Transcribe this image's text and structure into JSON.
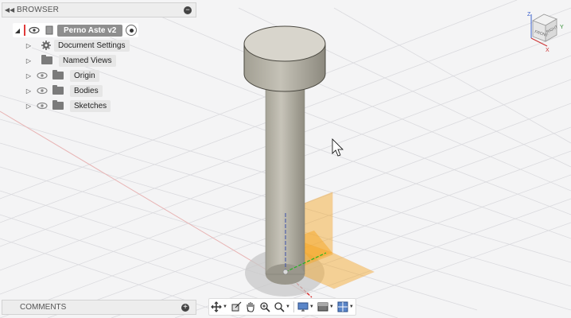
{
  "browser": {
    "title": "BROWSER",
    "root": {
      "name": "Perno Aste v2"
    },
    "items": [
      {
        "label": "Document Settings",
        "icon": "gear-icon"
      },
      {
        "label": "Named Views",
        "icon": "folder-icon"
      },
      {
        "label": "Origin",
        "icon": "folder-icon"
      },
      {
        "label": "Bodies",
        "icon": "folder-icon"
      },
      {
        "label": "Sketches",
        "icon": "folder-icon"
      }
    ]
  },
  "comments": {
    "title": "COMMENTS"
  },
  "viewcube": {
    "faces": [
      "FRONT",
      "RIGHT"
    ],
    "axes": [
      "Z",
      "Y",
      "X"
    ]
  },
  "toolbar": {
    "tools": [
      "orbit-icon",
      "look-at-icon",
      "pan-icon",
      "zoom-window-icon",
      "zoom-icon",
      "display-settings-icon",
      "visual-style-icon",
      "grid-settings-icon"
    ]
  },
  "colors": {
    "background": "#f4f4f5",
    "grid": "#d9d9dd",
    "body": "#b9b6ab",
    "plane": "#f5a623"
  }
}
